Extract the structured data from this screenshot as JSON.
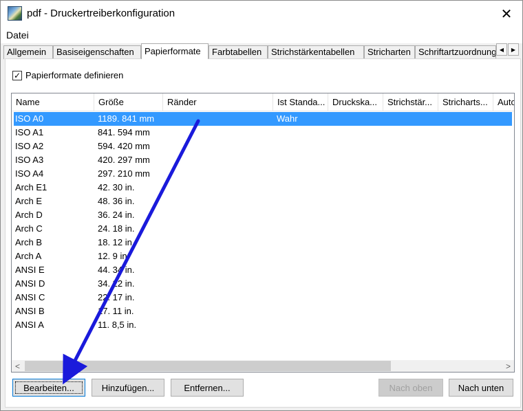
{
  "window": {
    "title": "pdf - Druckertreiberkonfiguration",
    "close_glyph": "✕"
  },
  "menu": {
    "items": [
      "Datei"
    ]
  },
  "tabs": [
    {
      "label": "Allgemein",
      "active": false
    },
    {
      "label": "Basiseigenschaften",
      "active": false
    },
    {
      "label": "Papierformate",
      "active": true
    },
    {
      "label": "Farbtabellen",
      "active": false
    },
    {
      "label": "Strichstärkentabellen",
      "active": false
    },
    {
      "label": "Stricharten",
      "active": false
    },
    {
      "label": "Schriftartzuordnung",
      "active": false
    }
  ],
  "tab_scroll": {
    "left_glyph": "◀",
    "right_glyph": "▶"
  },
  "define_formats": {
    "label": "Papierformate definieren",
    "checked": true,
    "check_glyph": "✓"
  },
  "list": {
    "columns": [
      "Name",
      "Größe",
      "Ränder",
      "Ist Standa...",
      "Druckska...",
      "Strichstär...",
      "Stricharts...",
      "Auto"
    ],
    "rows": [
      {
        "name": "ISO A0",
        "size": "1189. 841 mm",
        "margins": "",
        "standard": "Wahr",
        "selected": true
      },
      {
        "name": "ISO A1",
        "size": "841. 594 mm",
        "margins": "",
        "standard": "",
        "selected": false
      },
      {
        "name": "ISO A2",
        "size": "594. 420 mm",
        "margins": "",
        "standard": "",
        "selected": false
      },
      {
        "name": "ISO A3",
        "size": "420. 297 mm",
        "margins": "",
        "standard": "",
        "selected": false
      },
      {
        "name": "ISO A4",
        "size": "297. 210 mm",
        "margins": "",
        "standard": "",
        "selected": false
      },
      {
        "name": "Arch E1",
        "size": "42. 30 in.",
        "margins": "",
        "standard": "",
        "selected": false
      },
      {
        "name": "Arch E",
        "size": "48. 36 in.",
        "margins": "",
        "standard": "",
        "selected": false
      },
      {
        "name": "Arch D",
        "size": "36. 24 in.",
        "margins": "",
        "standard": "",
        "selected": false
      },
      {
        "name": "Arch C",
        "size": "24. 18 in.",
        "margins": "",
        "standard": "",
        "selected": false
      },
      {
        "name": "Arch B",
        "size": "18. 12 in.",
        "margins": "",
        "standard": "",
        "selected": false
      },
      {
        "name": "Arch A",
        "size": "12. 9 in.",
        "margins": "",
        "standard": "",
        "selected": false
      },
      {
        "name": "ANSI E",
        "size": "44. 34 in.",
        "margins": "",
        "standard": "",
        "selected": false
      },
      {
        "name": "ANSI D",
        "size": "34. 22 in.",
        "margins": "",
        "standard": "",
        "selected": false
      },
      {
        "name": "ANSI C",
        "size": "22. 17 in.",
        "margins": "",
        "standard": "",
        "selected": false
      },
      {
        "name": "ANSI B",
        "size": "17. 11 in.",
        "margins": "",
        "standard": "",
        "selected": false
      },
      {
        "name": "ANSI A",
        "size": "11. 8,5 in.",
        "margins": "",
        "standard": "",
        "selected": false
      }
    ],
    "scroll_left_glyph": "<",
    "scroll_right_glyph": ">"
  },
  "buttons": {
    "edit": "Bearbeiten...",
    "add": "Hinzufügen...",
    "remove": "Entfernen...",
    "move_up": "Nach oben",
    "move_down": "Nach unten"
  },
  "colors": {
    "selection": "#3399ff",
    "annotation_arrow": "#1a1adb"
  }
}
